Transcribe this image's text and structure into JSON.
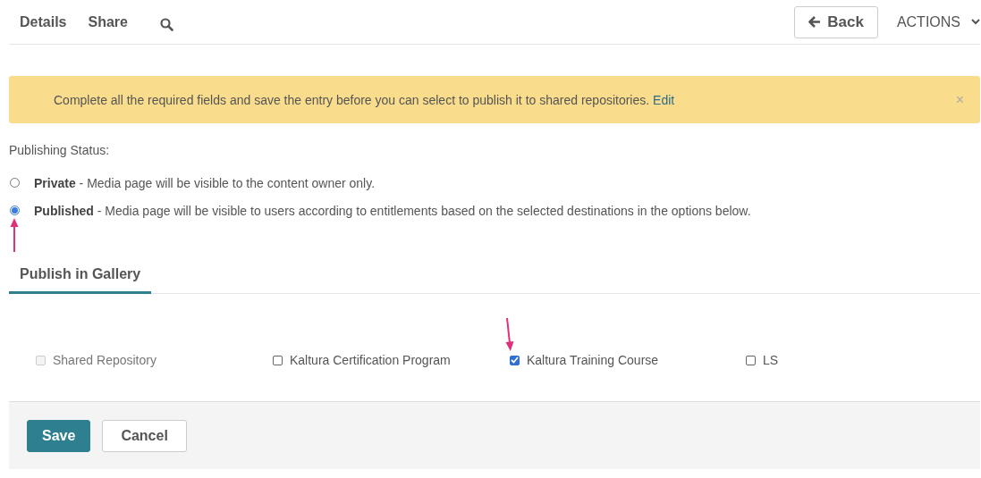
{
  "nav": {
    "tabs": [
      {
        "label": "Details",
        "selected": false
      },
      {
        "label": "Share",
        "selected": false
      }
    ],
    "back_button": "Back",
    "actions_menu": "ACTIONS"
  },
  "alert": {
    "message": "Complete all the required fields and save the entry before you can select to publish it to shared repositories.",
    "link": "Edit",
    "close": "×"
  },
  "publishing_status": {
    "label": "Publishing Status:",
    "options": [
      {
        "text": "**Private** - Media page will be visible to the content owner only.",
        "selected": false
      },
      {
        "text": "**Published** - Media page will be visible to users according to entitlements based on the selected destinations in the options below.",
        "selected": true
      }
    ]
  },
  "gallery_tab": {
    "label": "Publish in Gallery",
    "selected": true
  },
  "destinations": [
    {
      "label": "Shared Repository",
      "checked": false,
      "disabled": true
    },
    {
      "label": "Kaltura Certification Program",
      "checked": false,
      "disabled": false
    },
    {
      "label": "Kaltura Training Course",
      "checked": true,
      "disabled": false
    },
    {
      "label": "LS",
      "checked": false,
      "disabled": false
    }
  ],
  "footer": {
    "buttons": [
      {
        "label": "Save",
        "kind": "primary"
      },
      {
        "label": "Cancel",
        "kind": "secondary"
      }
    ]
  }
}
